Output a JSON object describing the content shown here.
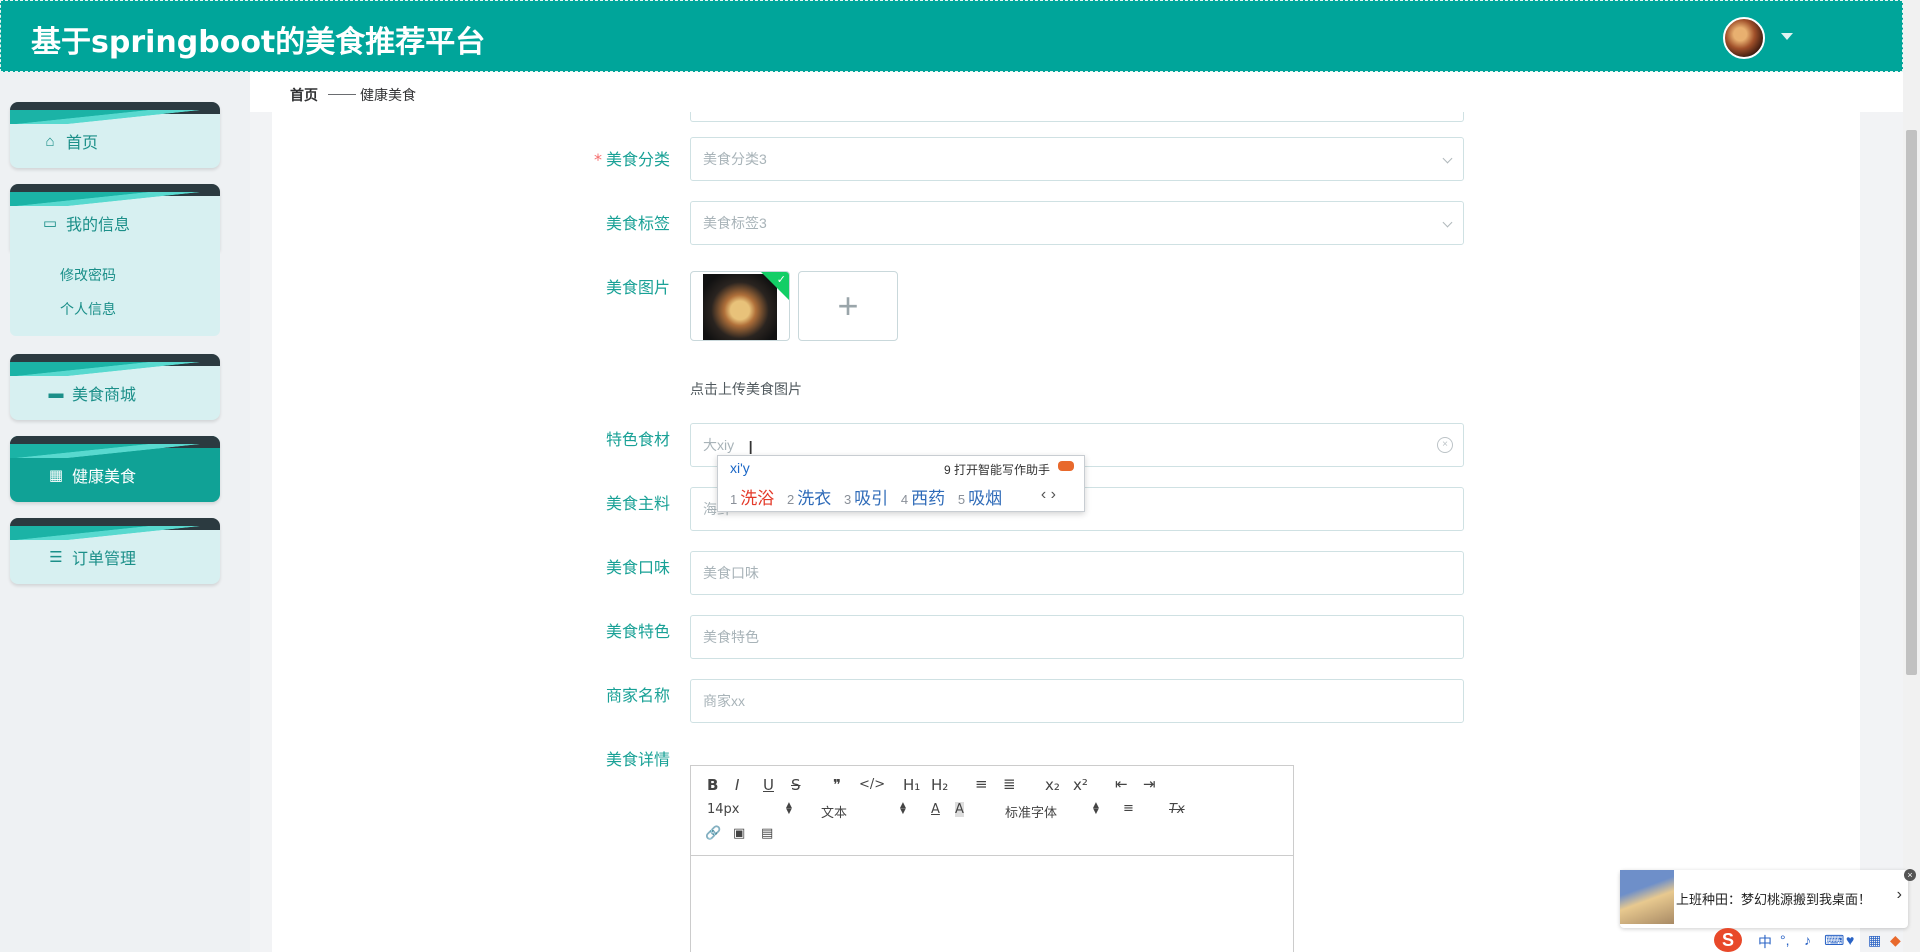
{
  "header": {
    "title": "基于springboot的美食推荐平台"
  },
  "sidebar": {
    "items": [
      {
        "label": "首页",
        "icon": "home-icon"
      },
      {
        "label": "我的信息",
        "icon": "card-icon"
      },
      {
        "label": "美食商城",
        "icon": "monitor-icon"
      },
      {
        "label": "健康美食",
        "icon": "grid-icon"
      },
      {
        "label": "订单管理",
        "icon": "list-icon"
      }
    ],
    "submenu": [
      "修改密码",
      "个人信息"
    ]
  },
  "breadcrumb": {
    "home": "首页",
    "separator": "——",
    "current": "健康美食"
  },
  "form": {
    "category": {
      "label": "美食分类",
      "value": "美食分类3"
    },
    "tag": {
      "label": "美食标签",
      "value": "美食标签3"
    },
    "image": {
      "label": "美食图片",
      "hint": "点击上传美食图片",
      "add": "+"
    },
    "ingredient": {
      "label": "特色食材",
      "value": "大xiy"
    },
    "main": {
      "label": "美食主料",
      "value": "海鲜"
    },
    "taste": {
      "label": "美食口味",
      "placeholder": "美食口味"
    },
    "feature": {
      "label": "美食特色",
      "placeholder": "美食特色"
    },
    "merchant": {
      "label": "商家名称",
      "value": "商家xx"
    },
    "detail": {
      "label": "美食详情"
    }
  },
  "ime": {
    "composition": "xi'y",
    "tip": "9 打开智能写作助手",
    "candidates": [
      {
        "n": "1",
        "text": "洗浴"
      },
      {
        "n": "2",
        "text": "洗衣"
      },
      {
        "n": "3",
        "text": "吸引"
      },
      {
        "n": "4",
        "text": "西药"
      },
      {
        "n": "5",
        "text": "吸烟"
      }
    ],
    "pager": "‹ ›"
  },
  "editor": {
    "font_size": "14px",
    "block": "文本",
    "font": "标准字体",
    "buttons": {
      "bold": "B",
      "italic": "I",
      "underline": "U",
      "strike": "S",
      "quote": "❞",
      "code": "</>",
      "h1": "H₁",
      "h2": "H₂",
      "ol": "≡",
      "ul": "≣",
      "sub": "x₂",
      "sup": "x²",
      "outdent": "⇤",
      "indent": "⇥",
      "color": "A",
      "bg": "A",
      "align": "≡",
      "clean": "Tx",
      "link": "🔗",
      "image": "▣",
      "video": "▤"
    }
  },
  "notification": {
    "text": "上班种田：梦幻桃源搬到我桌面！",
    "close": "×"
  },
  "tray": {
    "ime_logo": "S",
    "mode": "中"
  }
}
